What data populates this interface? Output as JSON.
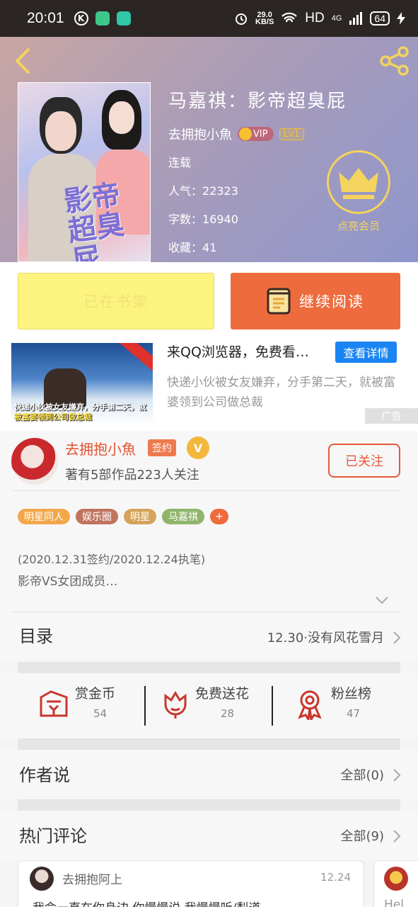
{
  "status_bar": {
    "time": "20:01",
    "apps": [
      "K",
      "",
      ""
    ],
    "speed_value": "29.0",
    "speed_unit": "KB/S",
    "network": "HD",
    "signal": "4G",
    "battery": "64"
  },
  "header": {
    "book_title": "马嘉祺：影帝超臭屁",
    "author": "去拥抱小魚",
    "vip_label": "VIP",
    "level_label": "Lv1",
    "status": "连载",
    "popularity_label": "人气：",
    "popularity": "22323",
    "word_count_label": "字数：",
    "word_count": "16940",
    "favorites_label": "收藏：",
    "favorites": "41",
    "member_label": "点亮会员",
    "cover_text": "影帝超臭屁",
    "accent_color": "#f4d35e"
  },
  "actions": {
    "shelf_label": "已在书架",
    "read_label": "继续阅读"
  },
  "ad": {
    "title": "来QQ浏览器，免费看…",
    "cta": "查看详情",
    "description": "快递小伙被女友嫌弃，分手第二天，就被富婆领到公司做总裁",
    "tag": "广告",
    "image_caption_prefix": "快递小伙被女友嫌弃，分手第二天，就",
    "image_caption_highlight": "被富婆领到公司做总裁"
  },
  "author_section": {
    "name": "去拥抱小魚",
    "sign_badge": "签约",
    "v_badge": "V",
    "stats": "著有5部作品223人关注",
    "follow_label": "已关注",
    "tags": [
      {
        "label": "明星同人",
        "color": "#f2a84a"
      },
      {
        "label": "娱乐圈",
        "color": "#c0745e"
      },
      {
        "label": "明星",
        "color": "#d6a35a"
      },
      {
        "label": "马嘉祺",
        "color": "#8fb56a"
      },
      {
        "label": "+",
        "color": "#ee6b3d"
      }
    ],
    "desc_line1": "(2020.12.31签约/2020.12.24执笔)",
    "desc_line2": "影帝VS女团成员…"
  },
  "toc": {
    "label": "目录",
    "latest": "12.30·没有风花雪月"
  },
  "stats": [
    {
      "label": "赏金币",
      "value": "54"
    },
    {
      "label": "免费送花",
      "value": "28"
    },
    {
      "label": "粉丝榜",
      "value": "47"
    }
  ],
  "author_says": {
    "label": "作者说",
    "all_label": "全部(0)"
  },
  "hot_comments": {
    "label": "热门评论",
    "all_label": "全部(9)",
    "items": [
      {
        "name": "去拥抱阿上",
        "time": "12.24",
        "text": "我命一直在你身边 你慢慢说 我慢慢听/梨道"
      }
    ],
    "second_preview": "Hel"
  }
}
